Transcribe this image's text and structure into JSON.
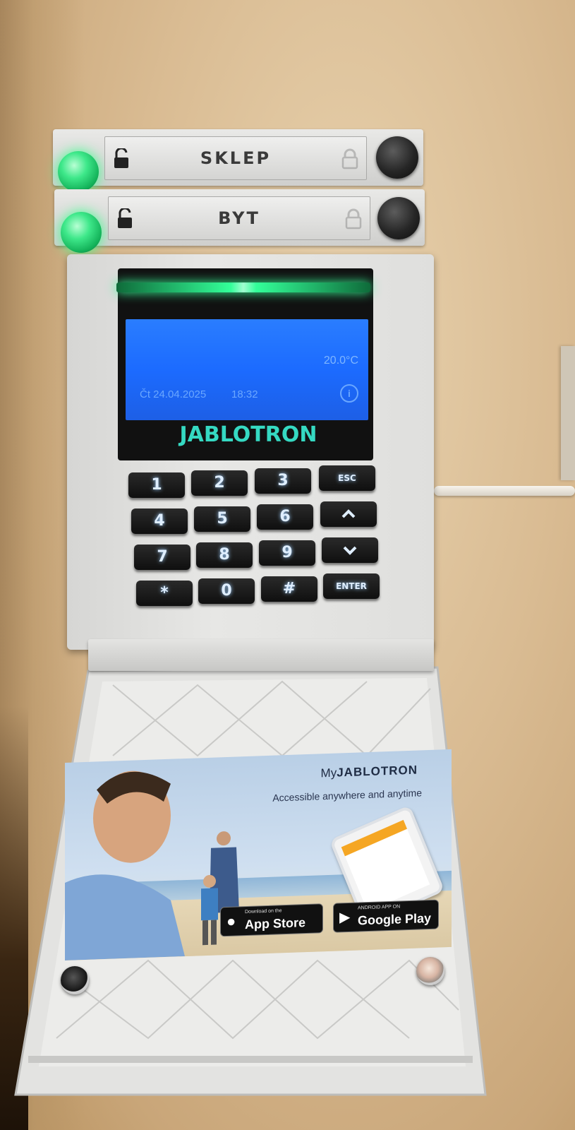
{
  "zones": [
    {
      "label": "SKLEP",
      "led_color": "#3ee88a",
      "state": "unlocked"
    },
    {
      "label": "BYT",
      "led_color": "#3ee88a",
      "state": "unlocked"
    }
  ],
  "display": {
    "temperature": "20.0°C",
    "date": "Čt 24.04.2025",
    "time": "18:32",
    "info_icon": "info-icon",
    "brand": "JABLOTRON"
  },
  "keys": [
    [
      "1",
      "2",
      "3",
      "ESC"
    ],
    [
      "4",
      "5",
      "6",
      "^"
    ],
    [
      "7",
      "8",
      "9",
      "v"
    ],
    [
      "*",
      "0",
      "#",
      "ENTER"
    ]
  ],
  "card": {
    "logo_prefix": "My",
    "logo_brand": "JABLOTRON",
    "tagline": "Accessible anywhere and anytime",
    "app_store_small": "Download on the",
    "app_store_big": "App Store",
    "google_play_small": "ANDROID APP ON",
    "google_play_big": "Google Play"
  },
  "colors": {
    "lcd": "#1c6bff",
    "accent_green": "#37ff9a",
    "brand_teal": "#35d9c2"
  }
}
